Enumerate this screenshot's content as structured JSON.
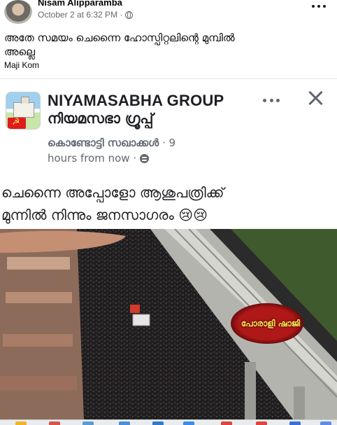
{
  "post": {
    "author": "Nisam Alipparamba",
    "timestamp": "October 2 at 6:32 PM ·",
    "caption_line1": "അതേ സമയം ചെന്നൈ ഹോസ്പിറ്റലിന്റെ മുമ്പിൽ",
    "caption_line2": "അല്ലെ",
    "tagged_name": "Maji Kom"
  },
  "shared_card": {
    "group_name_en": "NIYAMASABHA GROUP",
    "group_name_ml": "നിയമസഭാ ഗ്രൂപ്പ്",
    "poster_name": "കൊണ്ടോട്ടി സഖാക്കൾ",
    "poster_meta_dot": " · 9",
    "poster_time": "hours from now ·",
    "body_line1": "ചെന്നൈ അപ്പോളോ ആശുപത്രിക്ക്",
    "body_line2": "മുന്നിൽ നിന്നും ജനസാഗരം 😢😢",
    "watermark": "പോരാളി ഷാജി"
  },
  "colors": {
    "secondary_text": "#65676b",
    "watermark_red": "#b01818",
    "watermark_text": "#ffe04d"
  },
  "icons": [
    "globe-icon",
    "more-options-icon",
    "close-icon",
    "privacy-icon"
  ]
}
